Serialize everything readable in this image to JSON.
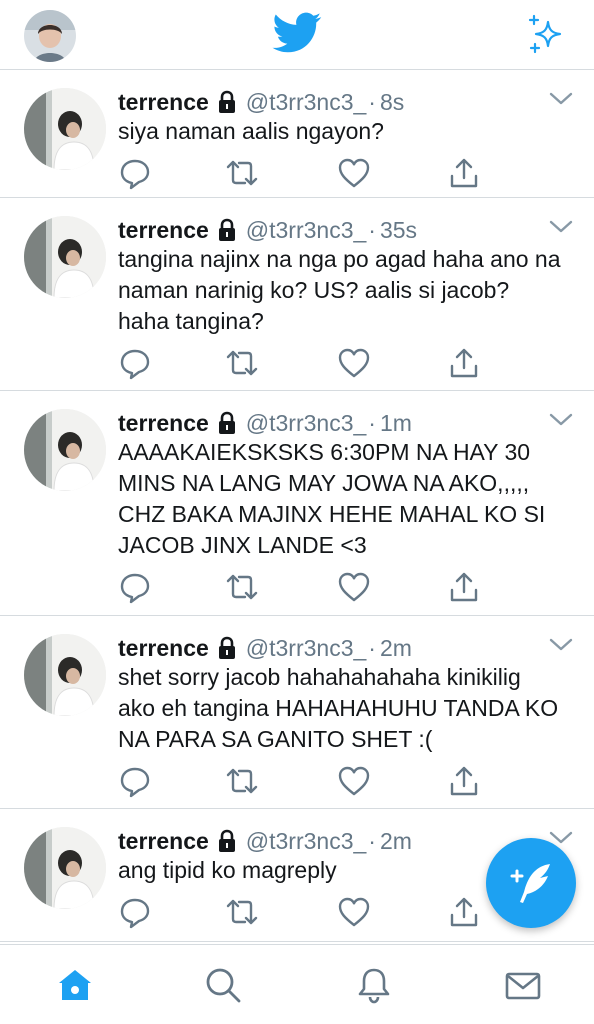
{
  "app": {
    "brand_color": "#1da1f2",
    "text_color": "#14171a",
    "muted_color": "#657786"
  },
  "header": {
    "avatar": "profile-avatar",
    "center_icon": "twitter-bird-icon",
    "right_icon": "sparkle-icon"
  },
  "tweets": [
    {
      "name": "terrence",
      "handle": "@t3rr3nc3_",
      "dot": "·",
      "time": "8s",
      "text": "siya naman aalis ngayon?"
    },
    {
      "name": "terrence",
      "handle": "@t3rr3nc3_",
      "dot": "·",
      "time": "35s",
      "text": "tangina najinx na nga po agad haha ano na naman narinig ko? US? aalis si jacob? haha tangina?"
    },
    {
      "name": "terrence",
      "handle": "@t3rr3nc3_",
      "dot": "·",
      "time": "1m",
      "text": "AAAAKAIEKSKSKS 6:30PM NA HAY 30 MINS NA LANG MAY JOWA NA AKO,,,,, CHZ BAKA MAJINX HEHE MAHAL KO SI JACOB JINX LANDE <3"
    },
    {
      "name": "terrence",
      "handle": "@t3rr3nc3_",
      "dot": "·",
      "time": "2m",
      "text": "shet sorry jacob hahahahahaha kinikilig ako eh tangina HAHAHAHUHU TANDA KO NA PARA SA GANITO SHET :("
    },
    {
      "name": "terrence",
      "handle": "@t3rr3nc3_",
      "dot": "·",
      "time": "2m",
      "text": "ang tipid ko magreply"
    }
  ],
  "tabbar": {
    "tabs": [
      "home-icon",
      "search-icon",
      "notifications-icon",
      "messages-icon"
    ],
    "active": "home-icon"
  },
  "fab": {
    "icon": "compose-icon"
  }
}
